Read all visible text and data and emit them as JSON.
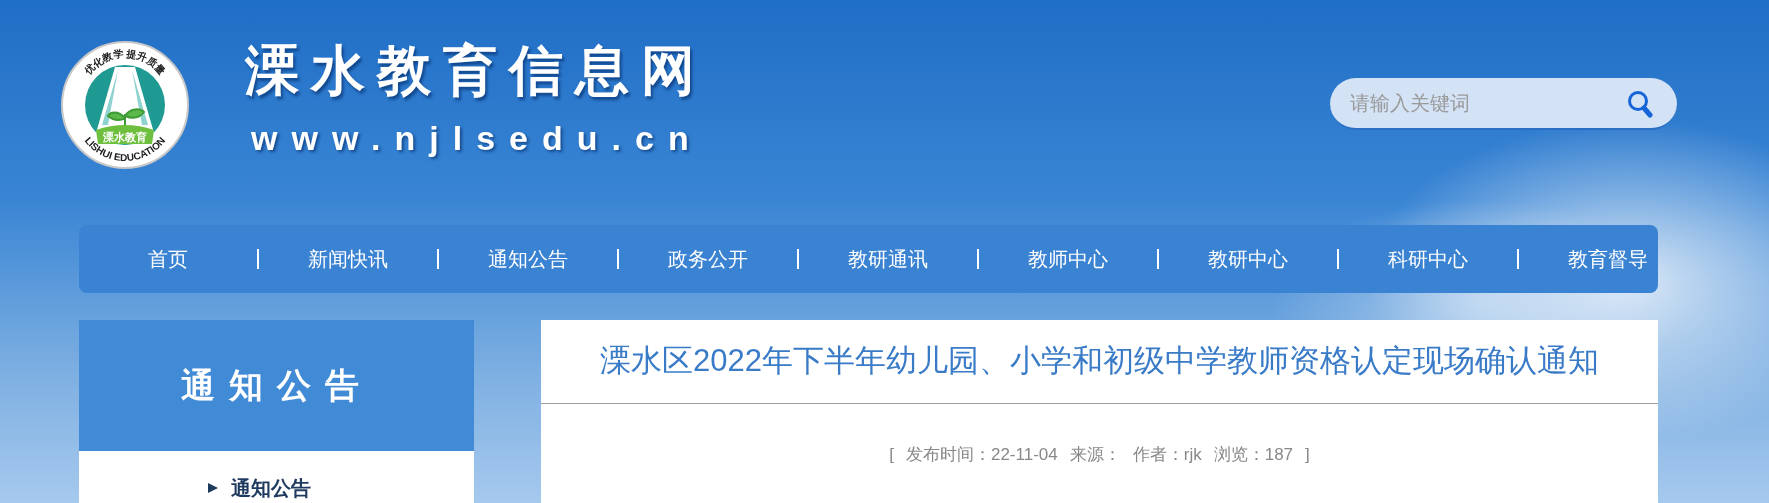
{
  "header": {
    "logo": {
      "arc_top": "优化教学 提升质量",
      "arc_bottom": "LISHUI EDUCATION",
      "inner": "溧水教育"
    },
    "site_name": "溧水教育信息网",
    "site_url": "www.njlsedu.cn"
  },
  "search": {
    "placeholder": "请输入关键词"
  },
  "nav": [
    {
      "label": "首页",
      "selected": false
    },
    {
      "label": "新闻快讯",
      "selected": false
    },
    {
      "label": "通知公告",
      "selected": false
    },
    {
      "label": "政务公开",
      "selected": false
    },
    {
      "label": "教研通讯",
      "selected": false
    },
    {
      "label": "教师中心",
      "selected": false
    },
    {
      "label": "教研中心",
      "selected": false
    },
    {
      "label": "科研中心",
      "selected": false
    },
    {
      "label": "教育督导",
      "selected": false
    }
  ],
  "sidebar": {
    "title": "通知公告",
    "items": [
      {
        "label": "通知公告",
        "selected": true
      }
    ]
  },
  "article": {
    "title": "溧水区2022年下半年幼儿园、小学和初级中学教师资格认定现场确认通知",
    "meta": {
      "open": "[",
      "items": [
        "发布时间：22-11-04",
        "来源：",
        "作者：rjk",
        "浏览：187"
      ],
      "close": "]"
    }
  }
}
